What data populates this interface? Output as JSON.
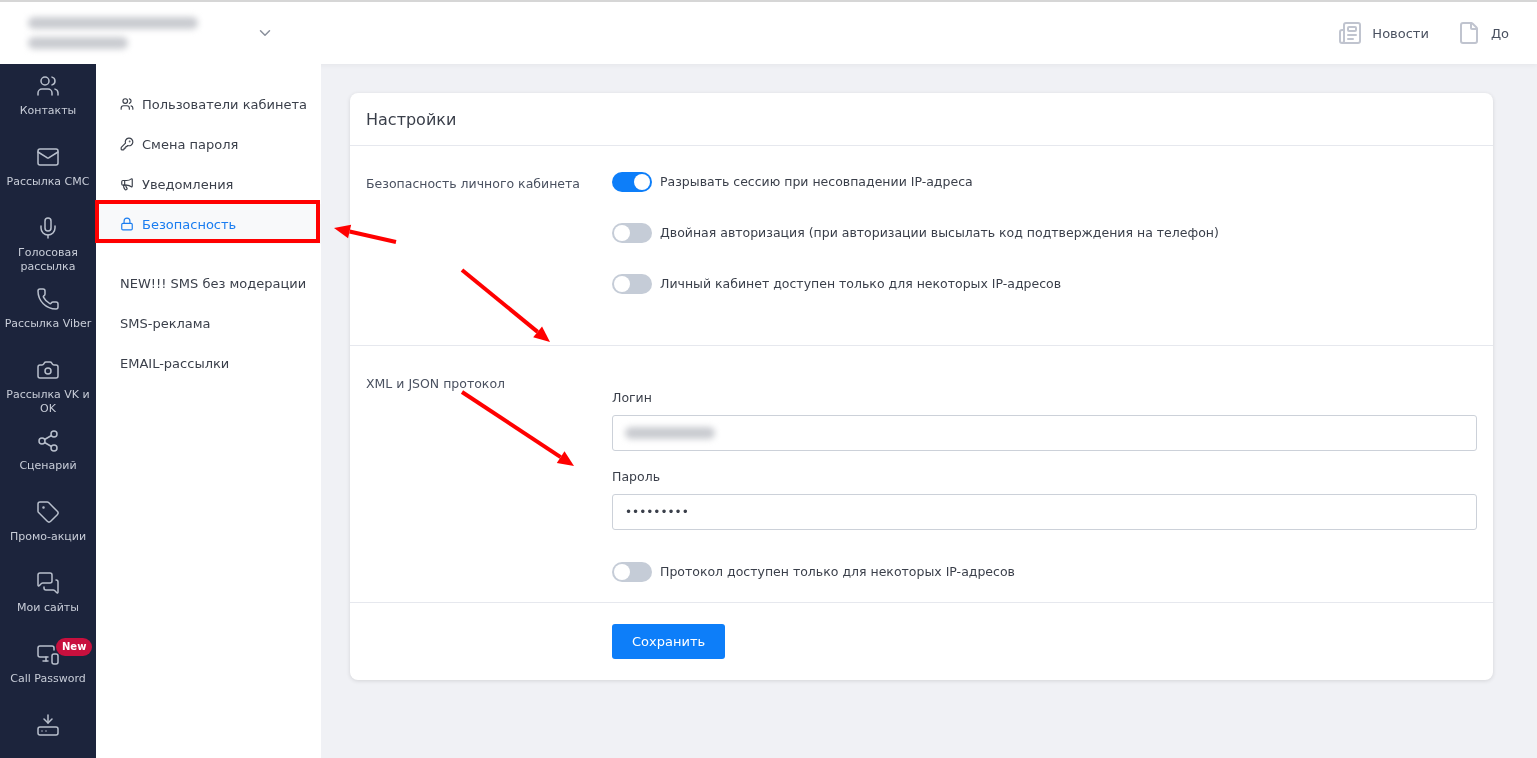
{
  "header": {
    "links": [
      {
        "label": "Новости"
      },
      {
        "label": "До"
      }
    ]
  },
  "sidebar": {
    "items": [
      {
        "label": "Контакты"
      },
      {
        "label": "Рассылка СМС"
      },
      {
        "label": "Голосовая рассылка"
      },
      {
        "label": "Рассылка Viber"
      },
      {
        "label": "Рассылка VK и OK"
      },
      {
        "label": "Сценарий"
      },
      {
        "label": "Промо-акции"
      },
      {
        "label": "Мои сайты"
      },
      {
        "label": "Call Password",
        "badge": "New"
      }
    ]
  },
  "submenu": {
    "items": [
      {
        "label": "Пользователи кабинета",
        "selected": false
      },
      {
        "label": "Смена пароля",
        "selected": false
      },
      {
        "label": "Уведомления",
        "selected": false
      },
      {
        "label": "Безопасность",
        "selected": true
      }
    ],
    "links": [
      "NEW!!! SMS без модерации",
      "SMS-реклама",
      "EMAIL-рассылки"
    ]
  },
  "card": {
    "title": "Настройки",
    "security": {
      "label": "Безопасность личного кабинета",
      "toggles": [
        {
          "label": "Разрывать сессию при несовпадении IP-адреса",
          "on": true
        },
        {
          "label": "Двойная авторизация (при авторизации высылать код подтверждения на телефон)",
          "on": false
        },
        {
          "label": "Личный кабинет доступен только для некоторых IP-адресов",
          "on": false
        }
      ]
    },
    "protocol": {
      "label": "XML и JSON протокол",
      "login_label": "Логин",
      "password_label": "Пароль",
      "password_value": "•••••••••",
      "toggle": {
        "label": "Протокол доступен только для некоторых IP-адресов",
        "on": false
      }
    },
    "save_button": "Сохранить"
  }
}
